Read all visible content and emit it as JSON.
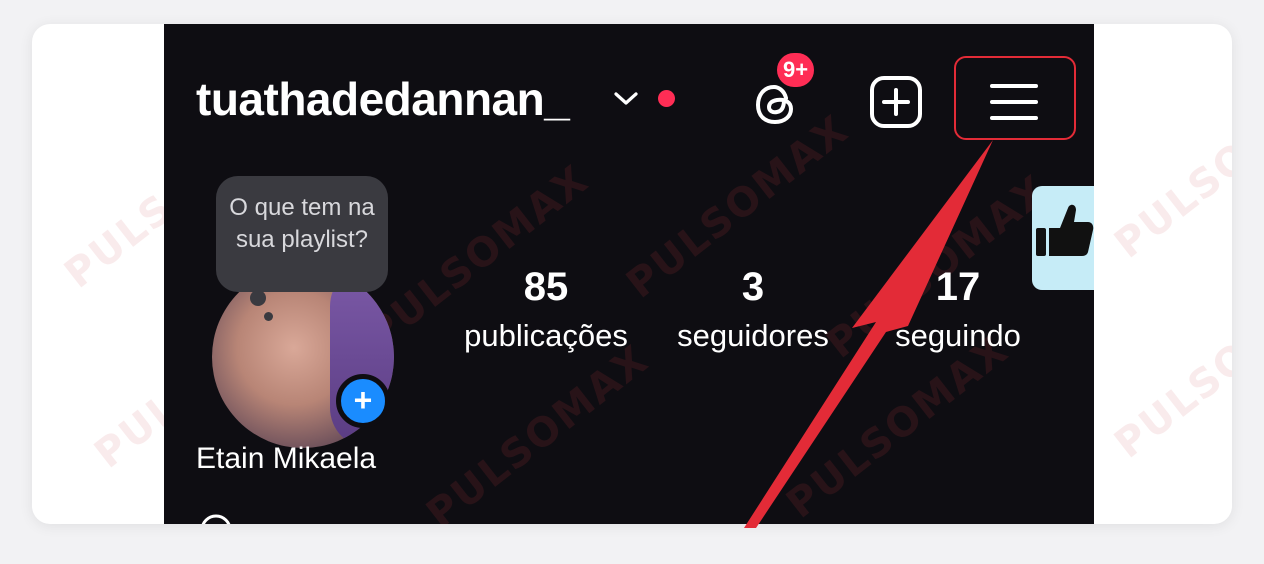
{
  "profile": {
    "username": "tuathadedannan_",
    "notification_badge": "9+",
    "display_name": "Etain Mikaela",
    "note_bubble_text": "O que tem na sua playlist?"
  },
  "stats": [
    {
      "value": "85",
      "label": "publicações"
    },
    {
      "value": "3",
      "label": "seguidores"
    },
    {
      "value": "17",
      "label": "seguindo"
    }
  ],
  "watermark_text": "PULSOMAX",
  "colors": {
    "background": "#0e0d12",
    "badge": "#ff2d55",
    "story_add": "#1a8cff",
    "annotation": "#e32b37",
    "like_tab": "#c6ecf7"
  },
  "icons": {
    "username_dropdown": "chevron-down-icon",
    "threads": "threads-icon",
    "create": "plus-square-icon",
    "menu": "hamburger-menu-icon",
    "like": "thumbs-up-icon"
  }
}
